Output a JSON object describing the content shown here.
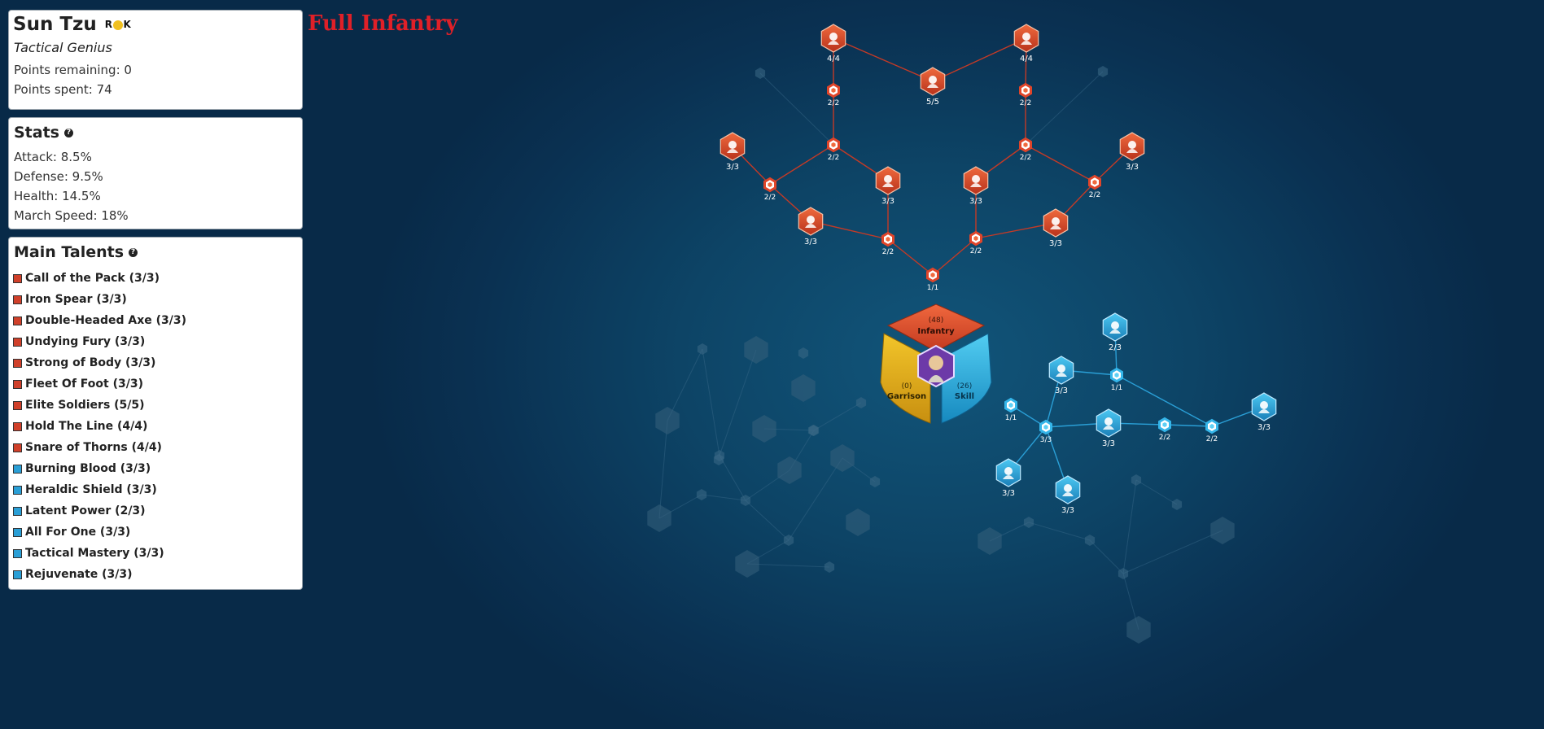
{
  "commander": {
    "name": "Sun Tzu",
    "badge": "ROK",
    "subtitle": "Tactical Genius",
    "points_remaining": "Points remaining: 0",
    "points_spent": "Points spent: 74"
  },
  "caption": "Full Infantry",
  "stats": {
    "title": "Stats",
    "items": [
      "Attack: 8.5%",
      "Defense: 9.5%",
      "Health: 14.5%",
      "March Speed: 18%"
    ]
  },
  "talents": {
    "title": "Main Talents",
    "colors": {
      "red": "#d0402a",
      "blue": "#2a9fd6"
    },
    "items": [
      {
        "label": "Call of the Pack (3/3)",
        "color": "red"
      },
      {
        "label": "Iron Spear (3/3)",
        "color": "red"
      },
      {
        "label": "Double-Headed Axe (3/3)",
        "color": "red"
      },
      {
        "label": "Undying Fury (3/3)",
        "color": "red"
      },
      {
        "label": "Strong of Body (3/3)",
        "color": "red"
      },
      {
        "label": "Fleet Of Foot (3/3)",
        "color": "red"
      },
      {
        "label": "Elite Soldiers (5/5)",
        "color": "red"
      },
      {
        "label": "Hold The Line (4/4)",
        "color": "red"
      },
      {
        "label": "Snare of Thorns (4/4)",
        "color": "red"
      },
      {
        "label": "Burning Blood (3/3)",
        "color": "blue"
      },
      {
        "label": "Heraldic Shield (3/3)",
        "color": "blue"
      },
      {
        "label": "Latent Power (2/3)",
        "color": "blue"
      },
      {
        "label": "All For One (3/3)",
        "color": "blue"
      },
      {
        "label": "Tactical Mastery (3/3)",
        "color": "blue"
      },
      {
        "label": "Rejuvenate (3/3)",
        "color": "blue"
      }
    ]
  },
  "center": {
    "infantry": {
      "label": "Infantry",
      "points": "(48)",
      "color": "#d9512d"
    },
    "garrison": {
      "label": "Garrison",
      "points": "(0)",
      "color": "#e8b420"
    },
    "skill": {
      "label": "Skill",
      "points": "(26)",
      "color": "#2aa9dc"
    }
  },
  "infantry_nodes": [
    {
      "id": "hold-the-line",
      "kind": "big",
      "icon": "armor-icon",
      "label": "4/4"
    },
    {
      "id": "snare-of-thorns",
      "kind": "big",
      "icon": "helmet-icon",
      "label": "4/4"
    },
    {
      "id": "elite-soldiers",
      "kind": "big",
      "icon": "eagle-icon",
      "label": "5/5"
    },
    {
      "id": "r-small-1",
      "kind": "small",
      "label": "2/2"
    },
    {
      "id": "r-small-2",
      "kind": "small",
      "label": "2/2"
    },
    {
      "id": "strong-of-body",
      "kind": "big",
      "icon": "strongman-icon",
      "label": "3/3"
    },
    {
      "id": "r-small-3",
      "kind": "small",
      "label": "2/2"
    },
    {
      "id": "r-small-4",
      "kind": "small",
      "label": "2/2"
    },
    {
      "id": "fleet-of-foot",
      "kind": "big",
      "icon": "winged-boot-icon",
      "label": "3/3"
    },
    {
      "id": "r-small-5",
      "kind": "small",
      "label": "2/2"
    },
    {
      "id": "double-headed-axe",
      "kind": "big",
      "icon": "axe-icon",
      "label": "3/3"
    },
    {
      "id": "undying-fury",
      "kind": "big",
      "icon": "flame-icon",
      "label": "3/3"
    },
    {
      "id": "r-small-6",
      "kind": "small",
      "label": "2/2"
    },
    {
      "id": "call-of-the-pack",
      "kind": "big",
      "icon": "wolf-icon",
      "label": "3/3"
    },
    {
      "id": "iron-spear",
      "kind": "big",
      "icon": "spear-icon",
      "label": "3/3"
    },
    {
      "id": "r-small-7",
      "kind": "small",
      "label": "2/2"
    },
    {
      "id": "r-small-8",
      "kind": "small",
      "label": "2/2"
    },
    {
      "id": "r-small-9",
      "kind": "small",
      "label": "1/1"
    }
  ],
  "skill_nodes": [
    {
      "id": "rejuvenate",
      "kind": "big",
      "icon": "heart-icon",
      "label": "2/3"
    },
    {
      "id": "burning-blood",
      "kind": "big",
      "icon": "blood-drop-icon",
      "label": "3/3"
    },
    {
      "id": "b-small-1",
      "kind": "small",
      "label": "1/1"
    },
    {
      "id": "b-small-2",
      "kind": "small",
      "label": "1/1"
    },
    {
      "id": "b-small-3",
      "kind": "small",
      "label": "3/3"
    },
    {
      "id": "tactical-mastery",
      "kind": "big",
      "icon": "scroll-icon",
      "label": "3/3"
    },
    {
      "id": "b-small-4",
      "kind": "small",
      "label": "2/2"
    },
    {
      "id": "b-small-5",
      "kind": "small",
      "label": "2/2"
    },
    {
      "id": "latent-power",
      "kind": "big",
      "icon": "hand-icon",
      "label": "3/3"
    },
    {
      "id": "heraldic-shield",
      "kind": "big",
      "icon": "shield-icon",
      "label": "3/3"
    },
    {
      "id": "all-for-one",
      "kind": "big",
      "icon": "swirl-icon",
      "label": "3/3"
    }
  ]
}
